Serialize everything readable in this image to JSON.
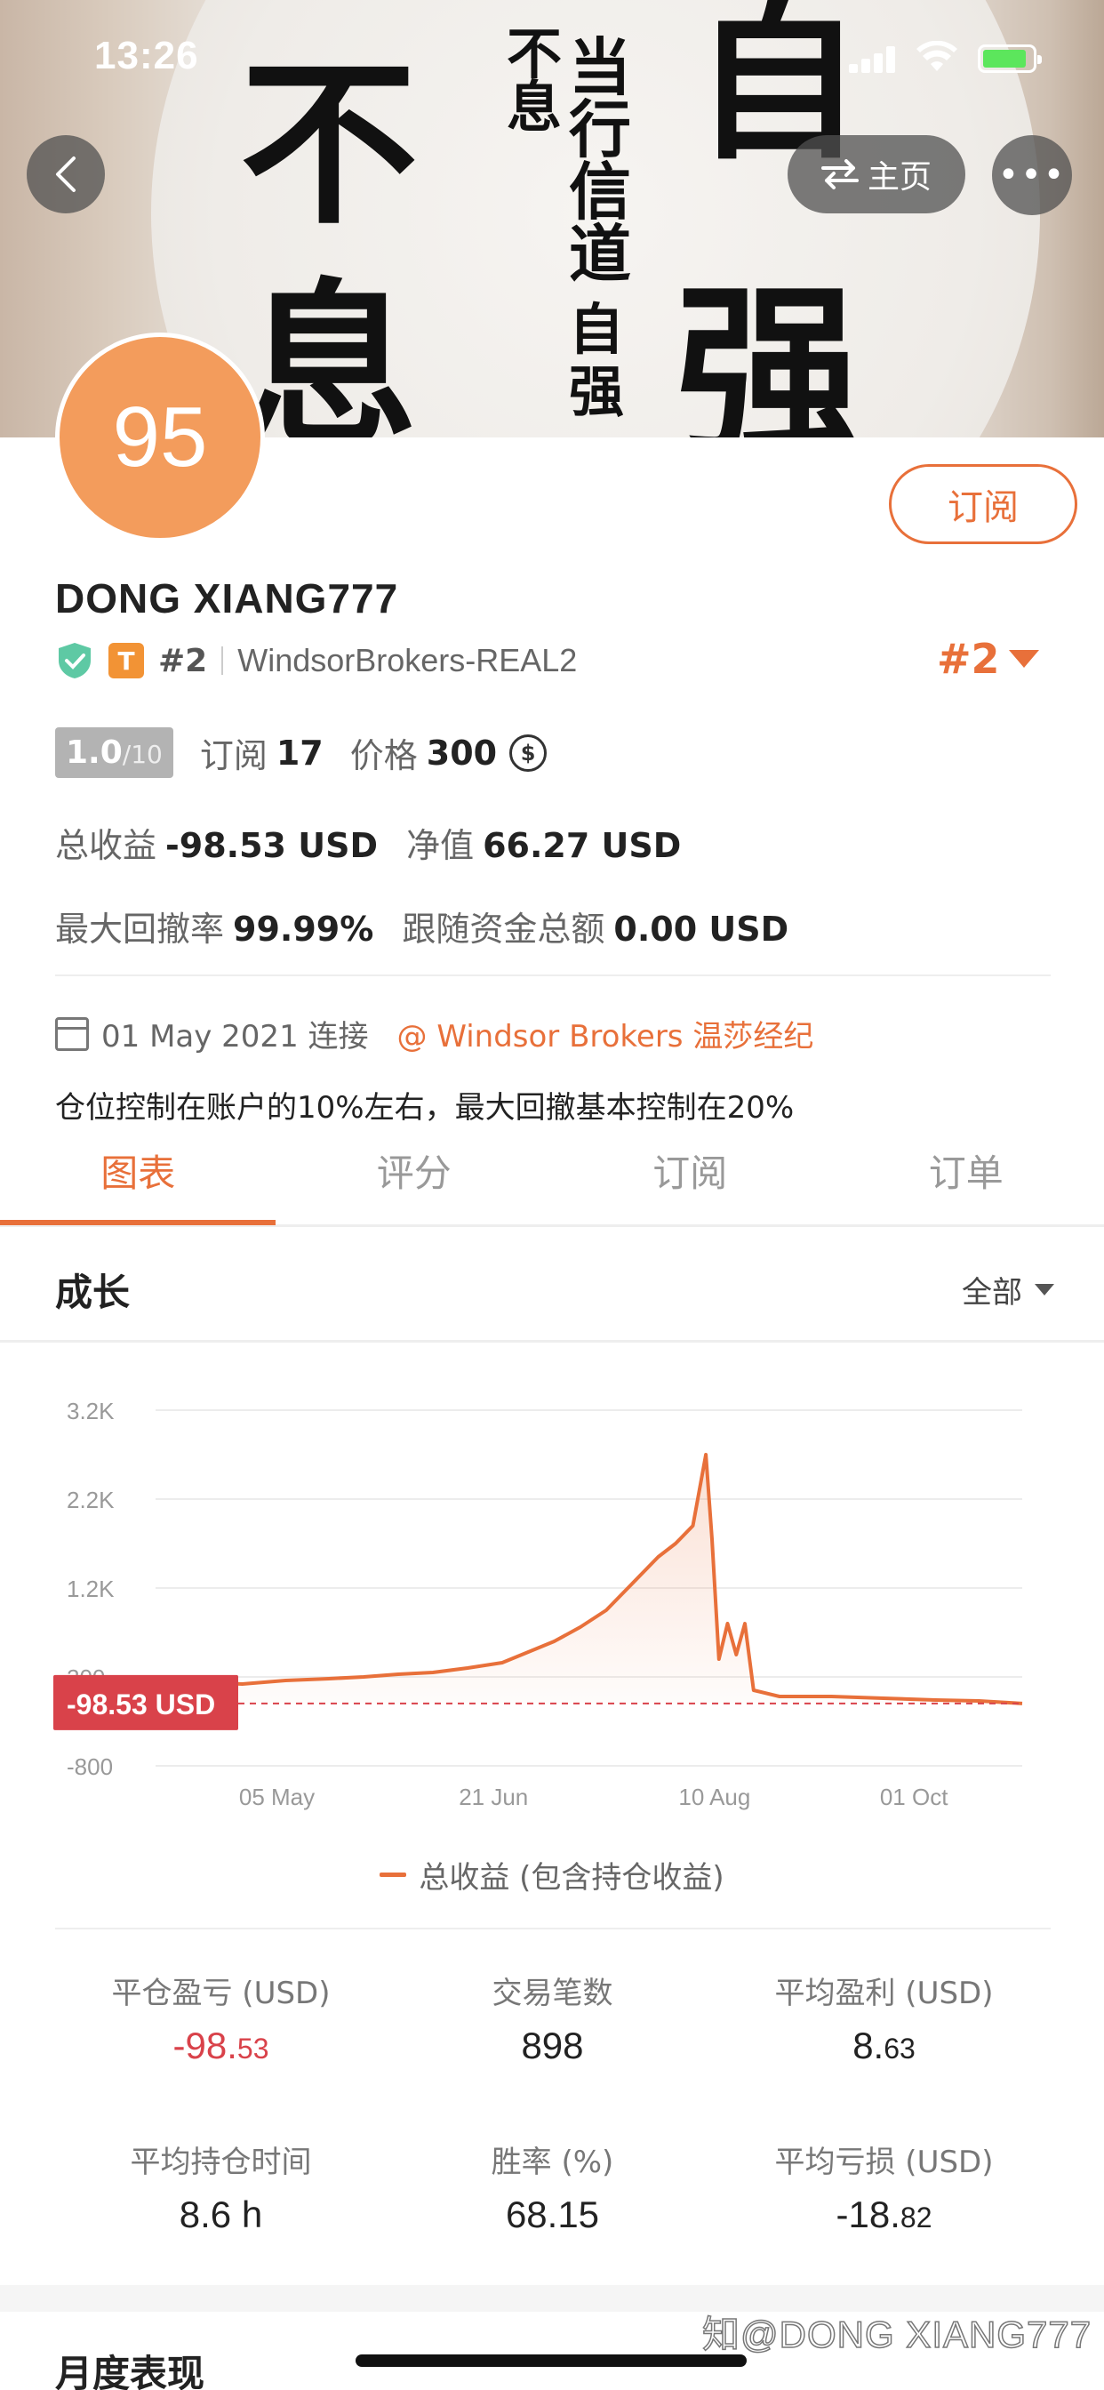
{
  "status_bar": {
    "time": "13:26"
  },
  "banner": {
    "calligraphy": [
      "自",
      "强",
      "不",
      "息",
      "当",
      "行",
      "信",
      "道",
      "自",
      "强",
      "不",
      "息"
    ]
  },
  "nav": {
    "home_label": "主页",
    "more": "•••"
  },
  "profile": {
    "score": "95",
    "subscribe_label": "订阅",
    "name": "DONG XIANG777",
    "rank_small": "#2",
    "broker_account": "WindsorBrokers-REAL2",
    "rank_big": "#2",
    "version_main": "1.0",
    "version_total": "/10",
    "subs_label": "订阅",
    "subs_count": "17",
    "price_label": "价格",
    "price_value": "300",
    "coin_symbol": "$",
    "total_return_label": "总收益",
    "total_return_value": "-98.53 USD",
    "equity_label": "净值",
    "equity_value": "66.27 USD",
    "max_dd_label": "最大回撤率",
    "max_dd_value": "99.99%",
    "follow_label": "跟随资金总额",
    "follow_value": "0.00 USD",
    "connect_date": "01 May 2021 连接",
    "broker_link": "@ Windsor Brokers 温莎经纪",
    "description": "仓位控制在账户的10%左右，最大回撤基本控制在20%"
  },
  "tabs": [
    "图表",
    "评分",
    "订阅",
    "订单"
  ],
  "section": {
    "title": "成长",
    "filter": "全部"
  },
  "chart_data": {
    "type": "line",
    "yticks": [
      "3.2K",
      "2.2K",
      "1.2K",
      "200",
      "-800"
    ],
    "ylim": [
      -800,
      3200
    ],
    "xticks": [
      "05 May",
      "21 Jun",
      "10 Aug",
      "01 Oct"
    ],
    "current_label": "-98.53 USD",
    "current_value": -98.53,
    "series": [
      {
        "name": "总收益 (包含持仓收益)",
        "values": [
          [
            0,
            100
          ],
          [
            0.05,
            140
          ],
          [
            0.1,
            120
          ],
          [
            0.15,
            160
          ],
          [
            0.2,
            180
          ],
          [
            0.24,
            200
          ],
          [
            0.28,
            230
          ],
          [
            0.32,
            250
          ],
          [
            0.36,
            300
          ],
          [
            0.4,
            360
          ],
          [
            0.43,
            480
          ],
          [
            0.46,
            600
          ],
          [
            0.49,
            760
          ],
          [
            0.52,
            950
          ],
          [
            0.55,
            1250
          ],
          [
            0.58,
            1550
          ],
          [
            0.6,
            1700
          ],
          [
            0.62,
            1900
          ],
          [
            0.635,
            2700
          ],
          [
            0.642,
            1750
          ],
          [
            0.65,
            400
          ],
          [
            0.66,
            800
          ],
          [
            0.67,
            450
          ],
          [
            0.68,
            800
          ],
          [
            0.69,
            50
          ],
          [
            0.72,
            -20
          ],
          [
            0.78,
            -20
          ],
          [
            0.84,
            -40
          ],
          [
            0.9,
            -60
          ],
          [
            0.95,
            -70
          ],
          [
            1.0,
            -98.53
          ]
        ]
      }
    ],
    "color": "#e8703a",
    "grid": true
  },
  "stats": [
    {
      "label": "平仓盈亏 (USD)",
      "value_main": "-98.",
      "value_small": "53",
      "negative": true
    },
    {
      "label": "交易笔数",
      "value_main": "898",
      "value_small": ""
    },
    {
      "label": "平均盈利 (USD)",
      "value_main": "8.",
      "value_small": "63"
    },
    {
      "label": "平均持仓时间",
      "value_main": "8.6 h",
      "value_small": ""
    },
    {
      "label": "胜率 (%)",
      "value_main": "68.15",
      "value_small": ""
    },
    {
      "label": "平均亏损 (USD)",
      "value_main": "-18.",
      "value_small": "82"
    }
  ],
  "monthly_title": "月度表现",
  "watermark": "知@DONG XIANG777"
}
